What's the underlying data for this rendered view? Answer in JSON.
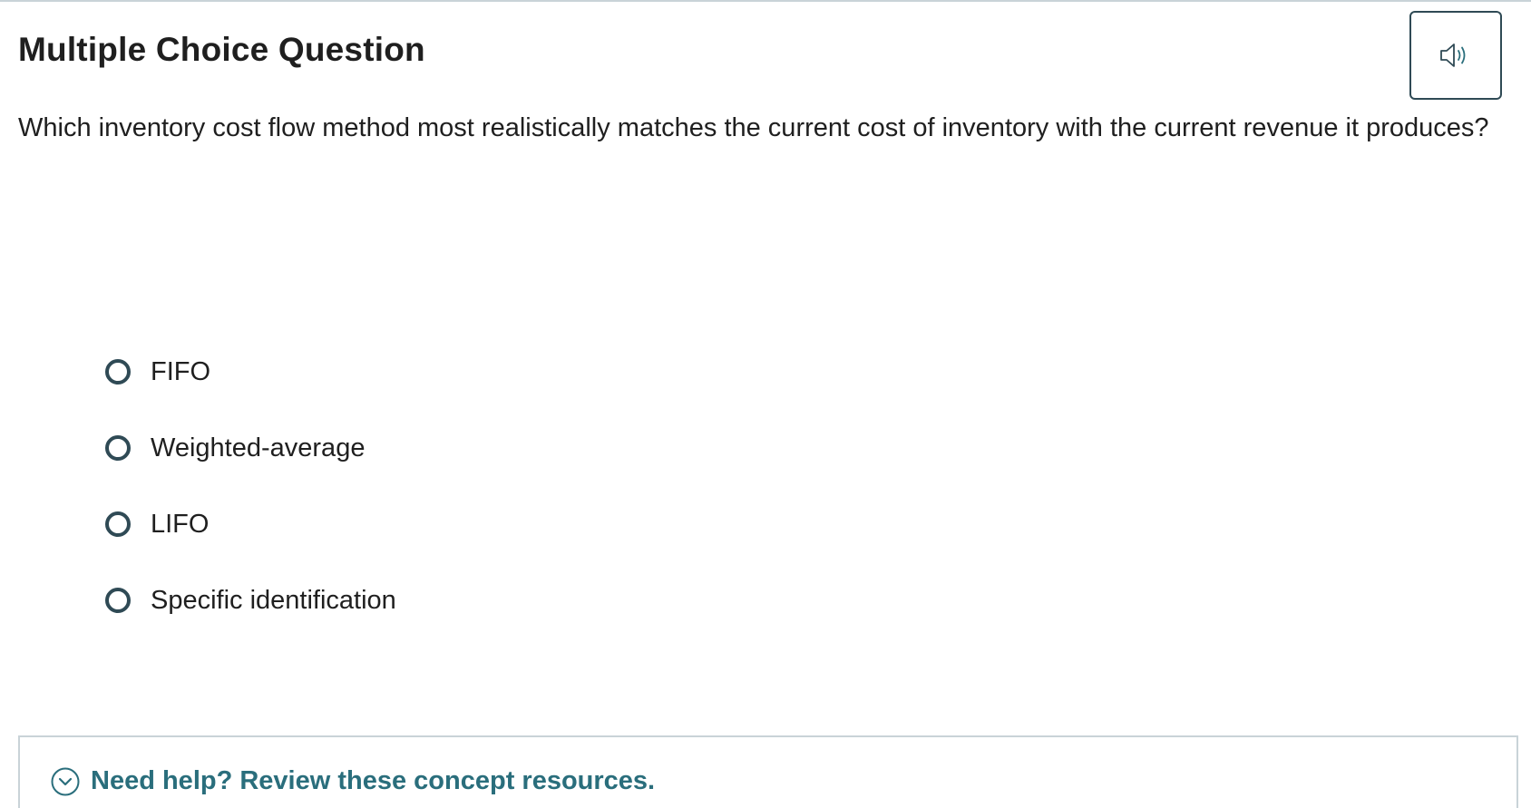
{
  "header": {
    "title": "Multiple Choice Question",
    "audio_icon": "speaker-icon"
  },
  "question": {
    "text": "Which inventory cost flow method most realistically matches the current cost of inventory with the current revenue it produces?"
  },
  "options": [
    {
      "label": "FIFO",
      "selected": false
    },
    {
      "label": "Weighted-average",
      "selected": false
    },
    {
      "label": "LIFO",
      "selected": false
    },
    {
      "label": "Specific identification",
      "selected": false
    }
  ],
  "help": {
    "label": "Need help? Review these concept resources.",
    "icon": "chevron-down-circle-icon"
  },
  "colors": {
    "accent": "#2a6e7c",
    "radio_border": "#2f4a55",
    "panel_border": "#c9d3d8"
  }
}
